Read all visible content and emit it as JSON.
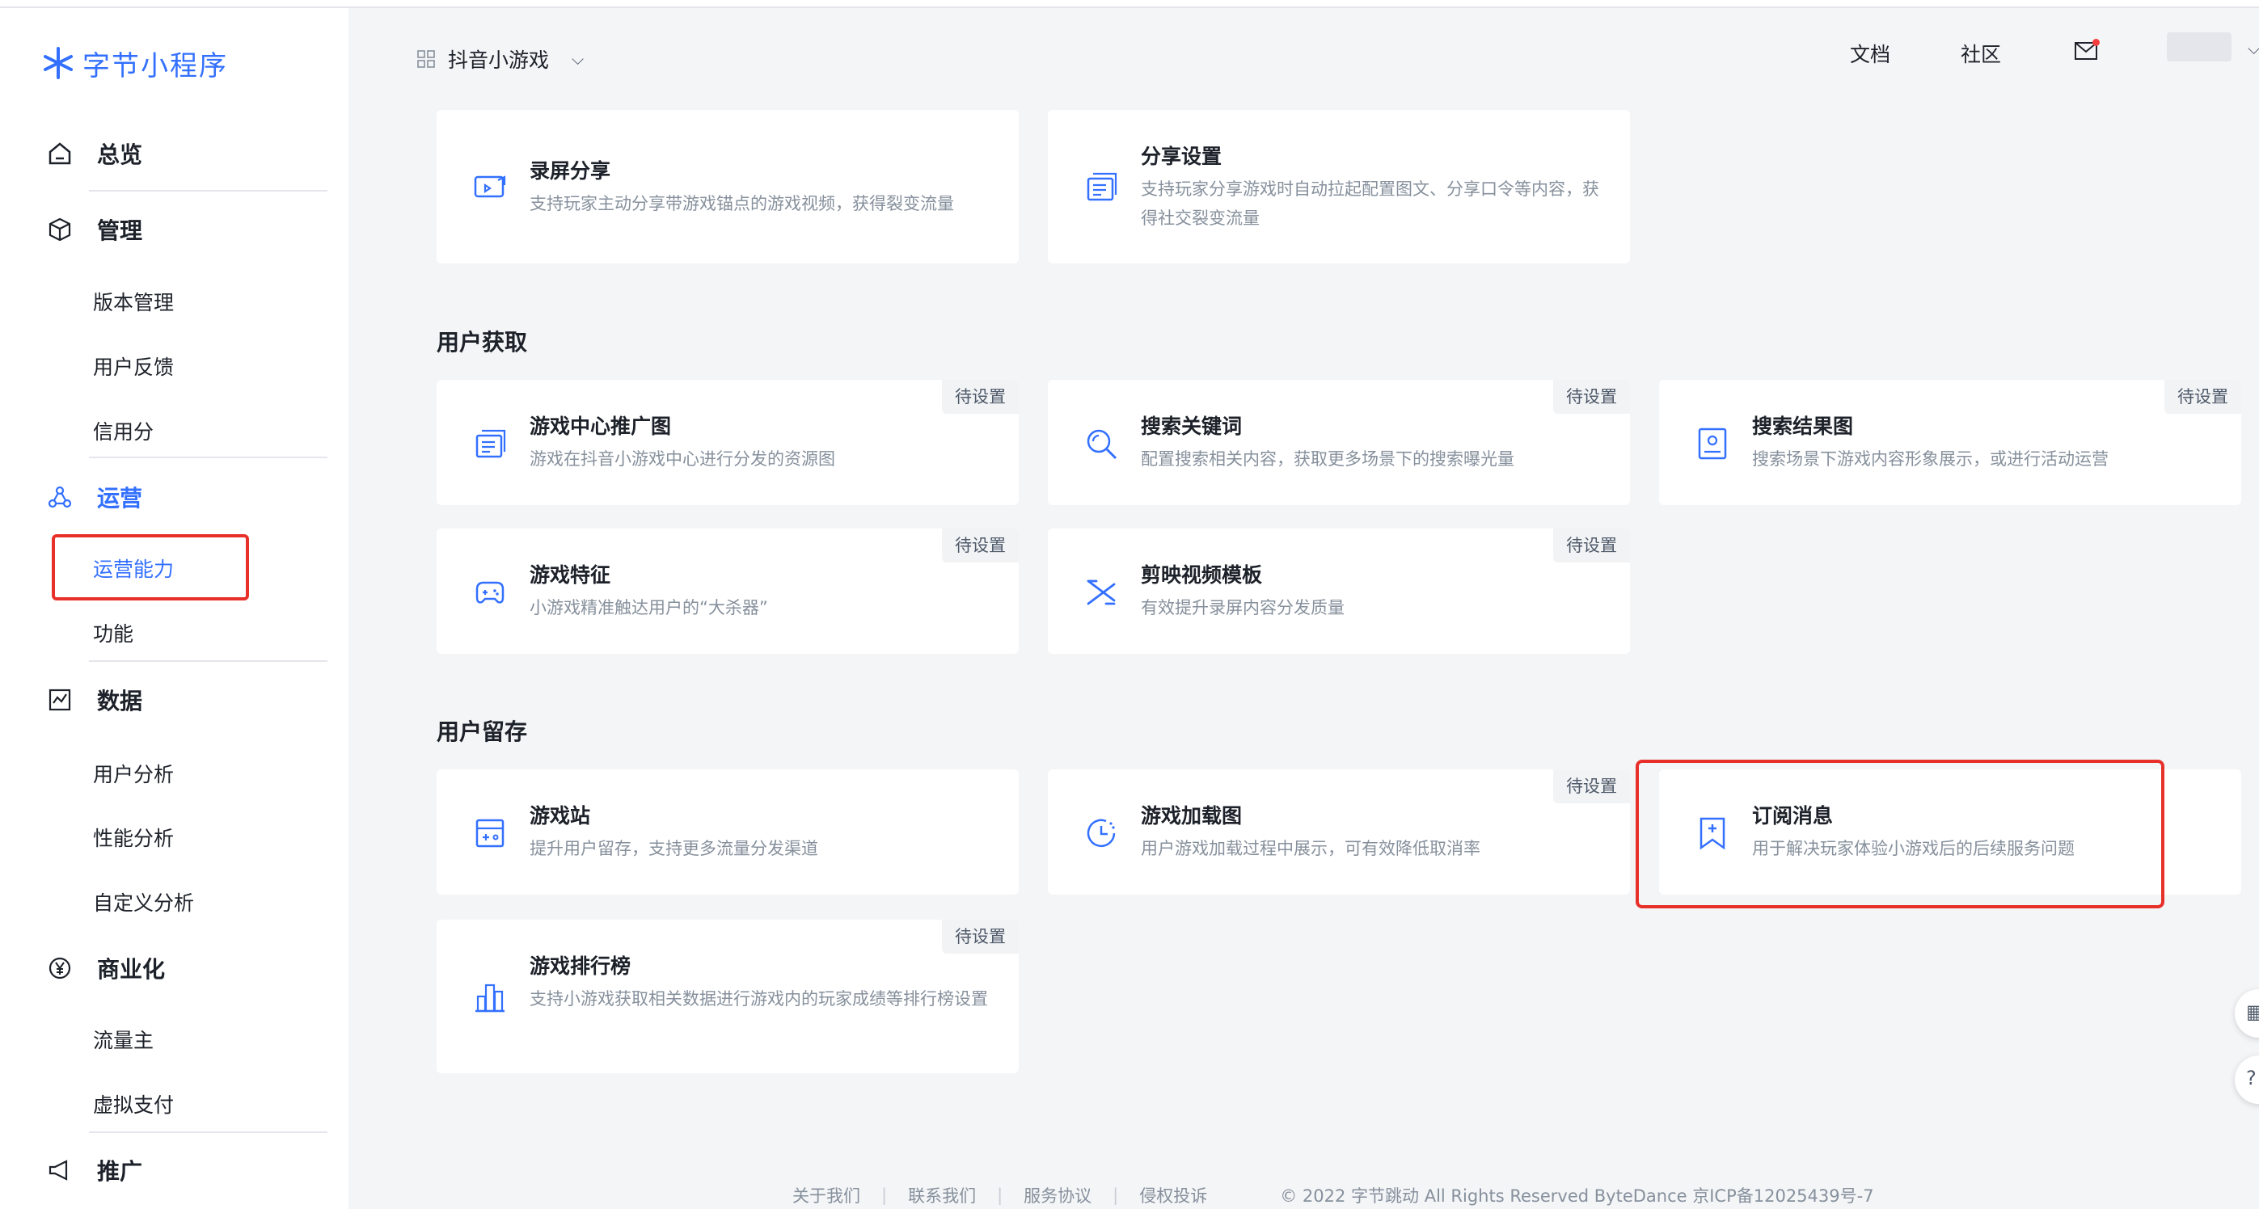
{
  "brand": {
    "name": "字节小程序",
    "color": "#3370ff"
  },
  "header": {
    "app_name": "抖音小游戏",
    "links": [
      "文档",
      "社区"
    ],
    "mail_icon": "mail-icon",
    "notification_color": "#f53f3f"
  },
  "sidebar": {
    "overview": "总览",
    "manage": {
      "label": "管理",
      "items": [
        "版本管理",
        "用户反馈",
        "信用分"
      ]
    },
    "operation": {
      "label": "运营",
      "items": [
        "运营能力",
        "功能"
      ],
      "active_item": "运营能力"
    },
    "data": {
      "label": "数据",
      "items": [
        "用户分析",
        "性能分析",
        "自定义分析"
      ]
    },
    "business": {
      "label": "商业化",
      "items": [
        "流量主",
        "虚拟支付"
      ]
    },
    "promote": {
      "label": "推广"
    }
  },
  "sections": [
    {
      "title": "",
      "cards": [
        {
          "title": "录屏分享",
          "desc": "支持玩家主动分享带游戏锚点的游戏视频，获得裂变流量",
          "icon": "video-share-icon",
          "badge": ""
        },
        {
          "title": "分享设置",
          "desc": "支持玩家分享游戏时自动拉起配置图文、分享口令等内容，获得社交裂变流量",
          "icon": "share-settings-icon",
          "badge": ""
        }
      ]
    },
    {
      "title": "用户获取",
      "cards": [
        {
          "title": "游戏中心推广图",
          "desc": "游戏在抖音小游戏中心进行分发的资源图",
          "icon": "promo-image-icon",
          "badge": "待设置"
        },
        {
          "title": "搜索关键词",
          "desc": "配置搜索相关内容，获取更多场景下的搜索曝光量",
          "icon": "search-icon",
          "badge": "待设置"
        },
        {
          "title": "搜索结果图",
          "desc": "搜索场景下游戏内容形象展示，或进行活动运营",
          "icon": "search-result-icon",
          "badge": "待设置"
        },
        {
          "title": "游戏特征",
          "desc": "小游戏精准触达用户的“大杀器”",
          "icon": "gamepad-icon",
          "badge": "待设置"
        },
        {
          "title": "剪映视频模板",
          "desc": "有效提升录屏内容分发质量",
          "icon": "capcut-icon",
          "badge": "待设置"
        }
      ]
    },
    {
      "title": "用户留存",
      "cards": [
        {
          "title": "游戏站",
          "desc": "提升用户留存，支持更多流量分发渠道",
          "icon": "game-station-icon",
          "badge": ""
        },
        {
          "title": "游戏加载图",
          "desc": "用户游戏加载过程中展示，可有效降低取消率",
          "icon": "loading-clock-icon",
          "badge": "待设置"
        },
        {
          "title": "订阅消息",
          "desc": "用于解决玩家体验小游戏后的后续服务问题",
          "icon": "bookmark-plus-icon",
          "badge": ""
        },
        {
          "title": "游戏排行榜",
          "desc": "支持小游戏获取相关数据进行游戏内的玩家成绩等排行榜设置",
          "icon": "leaderboard-icon",
          "badge": "待设置"
        }
      ]
    }
  ],
  "footer": {
    "links": [
      "关于我们",
      "联系我们",
      "服务协议",
      "侵权投诉"
    ],
    "copyright": "© 2022 字节跳动 All Rights Reserved ByteDance 京ICP备12025439号-7"
  },
  "colors": {
    "accent": "#3370ff",
    "highlight": "#e8302a",
    "muted": "#86909c"
  }
}
